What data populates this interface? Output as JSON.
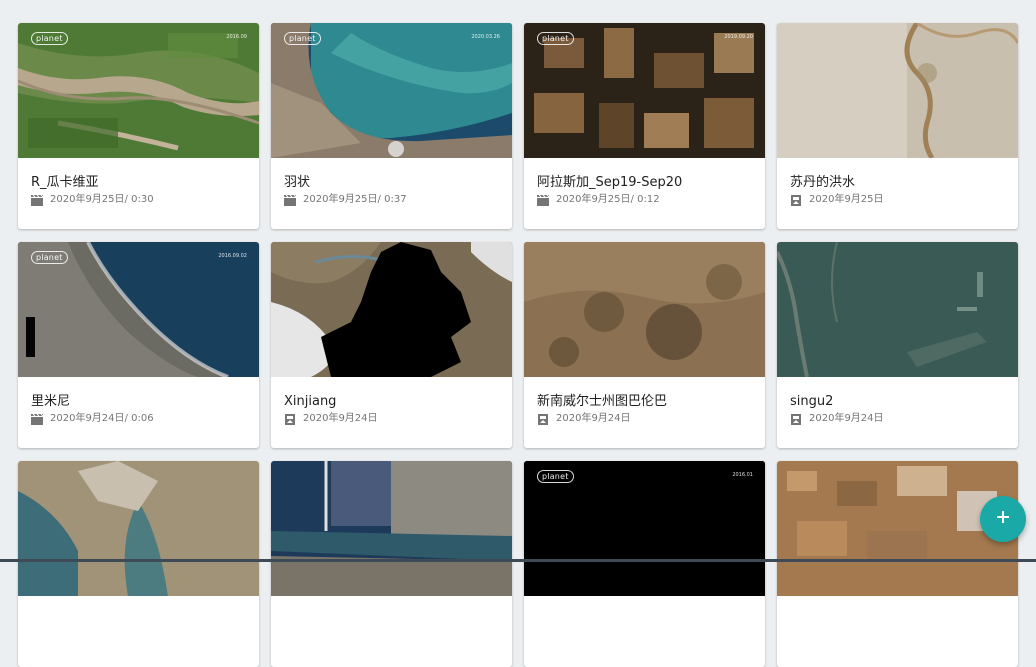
{
  "colors": {
    "background": "#eceff1",
    "fab": "#1aa9a7",
    "title_text": "#212121",
    "meta_text": "#757575"
  },
  "icons": {
    "video": "movie-icon",
    "image": "image-icon",
    "fab": "plus-icon"
  },
  "watermark": "planet",
  "cards": [
    {
      "title": "R_瓜卡维亚",
      "date": "2020年9月25日",
      "duration": " / 0:30",
      "type": "video",
      "stamp": "2016.09",
      "logo": true
    },
    {
      "title": "羽状",
      "date": "2020年9月25日",
      "duration": " / 0:37",
      "type": "video",
      "stamp": "2020.03.26",
      "logo": true
    },
    {
      "title": "阿拉斯加_Sep19-Sep20",
      "date": "2020年9月25日",
      "duration": " / 0:12",
      "type": "video",
      "stamp": "2019.09.20",
      "logo": true
    },
    {
      "title": "苏丹的洪水",
      "date": "2020年9月25日",
      "duration": "",
      "type": "image",
      "stamp": "",
      "logo": false
    },
    {
      "title": "里米尼",
      "date": "2020年9月24日",
      "duration": " / 0:06",
      "type": "video",
      "stamp": "2016.09.02",
      "logo": true
    },
    {
      "title": "Xinjiang",
      "date": "2020年9月24日",
      "duration": "",
      "type": "image",
      "stamp": "",
      "logo": false
    },
    {
      "title": "新南威尔士州图巴伦巴",
      "date": "2020年9月24日",
      "duration": "",
      "type": "image",
      "stamp": "",
      "logo": false
    },
    {
      "title": "singu2",
      "date": "2020年9月24日",
      "duration": "",
      "type": "image",
      "stamp": "",
      "logo": false
    },
    {
      "title": "",
      "date": "",
      "duration": "",
      "type": "",
      "stamp": "",
      "logo": false
    },
    {
      "title": "",
      "date": "",
      "duration": "",
      "type": "",
      "stamp": "",
      "logo": false
    },
    {
      "title": "",
      "date": "",
      "duration": "",
      "type": "",
      "stamp": "2016.01",
      "logo": true
    },
    {
      "title": "",
      "date": "",
      "duration": "",
      "type": "",
      "stamp": "",
      "logo": false
    }
  ]
}
